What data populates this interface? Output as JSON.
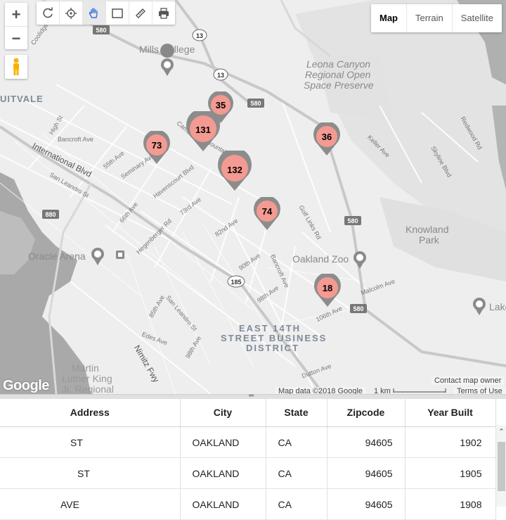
{
  "map": {
    "zoom_in": "+",
    "zoom_out": "−",
    "map_types": [
      "Map",
      "Terrain",
      "Satellite"
    ],
    "selected_map_type": "Map",
    "toolbar_icons": [
      "refresh-icon",
      "locate-icon",
      "pan-hand-icon",
      "rectangle-select-icon",
      "ruler-icon",
      "print-icon"
    ],
    "place_labels": {
      "mills_college": "Mills College",
      "fruitvale": "UITVALE",
      "leona": "Leona Canyon",
      "leona2": "Regional Open",
      "leona3": "Space Preserve",
      "knowland": "Knowland",
      "knowland2": "Park",
      "oakland_zoo": "Oakland Zoo",
      "arena": "Oracle Arena",
      "lake": "Lake",
      "district1": "EAST 14TH",
      "district2": "STREET BUSINESS",
      "district3": "DISTRICT",
      "mlk1": "Martin",
      "mlk2": "Luther King",
      "mlk3": "Jr. Regional"
    },
    "street_labels": {
      "intl": "International Blvd",
      "san_leandro": "San Leandro St",
      "seminary": "Seminary Ave",
      "havenscourt": "Havenscourt Blvd",
      "ave73": "73rd Ave",
      "ave66": "66th Ave",
      "hegenberger": "Hegenberger Rd",
      "ave82": "82nd Ave",
      "ave90": "90th Ave",
      "ave98": "98th Ave",
      "bancroft": "Bancroft Ave",
      "bancroft2": "Bancroft Ave",
      "ave55": "55th Ave",
      "golf": "Golf Links Rd",
      "keller": "Keller Ave",
      "skyline": "Skyline Blvd",
      "redwood": "Redwood Rd",
      "mcolm": "Malcolm Ave",
      "ave106": "106th Ave",
      "ave85": "85th Ave",
      "sanleandro2": "San Leandro St",
      "edes": "Edes Ave",
      "nimitz": "Nimitz Fwy",
      "ave98b": "98th Ave",
      "dutton": "Dutton Ave",
      "highst": "High St",
      "coolidge": "Coolidge",
      "campus": "Camden St",
      "mtnblvd": "Mountain Blvd"
    },
    "route_shields": [
      "580",
      "13",
      "13",
      "580",
      "880",
      "580",
      "185",
      "580"
    ],
    "clusters": [
      {
        "count": "35"
      },
      {
        "count": "131"
      },
      {
        "count": "73"
      },
      {
        "count": "132"
      },
      {
        "count": "36"
      },
      {
        "count": "74"
      },
      {
        "count": "18"
      }
    ],
    "google_logo": "Google",
    "attribution": "Map data ©2018 Google",
    "scale_label": "1 km",
    "contact": "Contact map owner",
    "terms": "Terms of Use",
    "colors": {
      "cluster_fill": "#f39a92",
      "cluster_border": "#8c8c8c",
      "map_bg": "#eeeeee",
      "water": "#a9a9a9"
    }
  },
  "table": {
    "headers": [
      "Address",
      "City",
      "State",
      "Zipcode",
      "Year Built"
    ],
    "rows": [
      [
        "ST",
        "OAKLAND",
        "CA",
        "94605",
        "1902"
      ],
      [
        "ST",
        "OAKLAND",
        "CA",
        "94605",
        "1905"
      ],
      [
        "AVE",
        "OAKLAND",
        "CA",
        "94605",
        "1908"
      ]
    ]
  }
}
